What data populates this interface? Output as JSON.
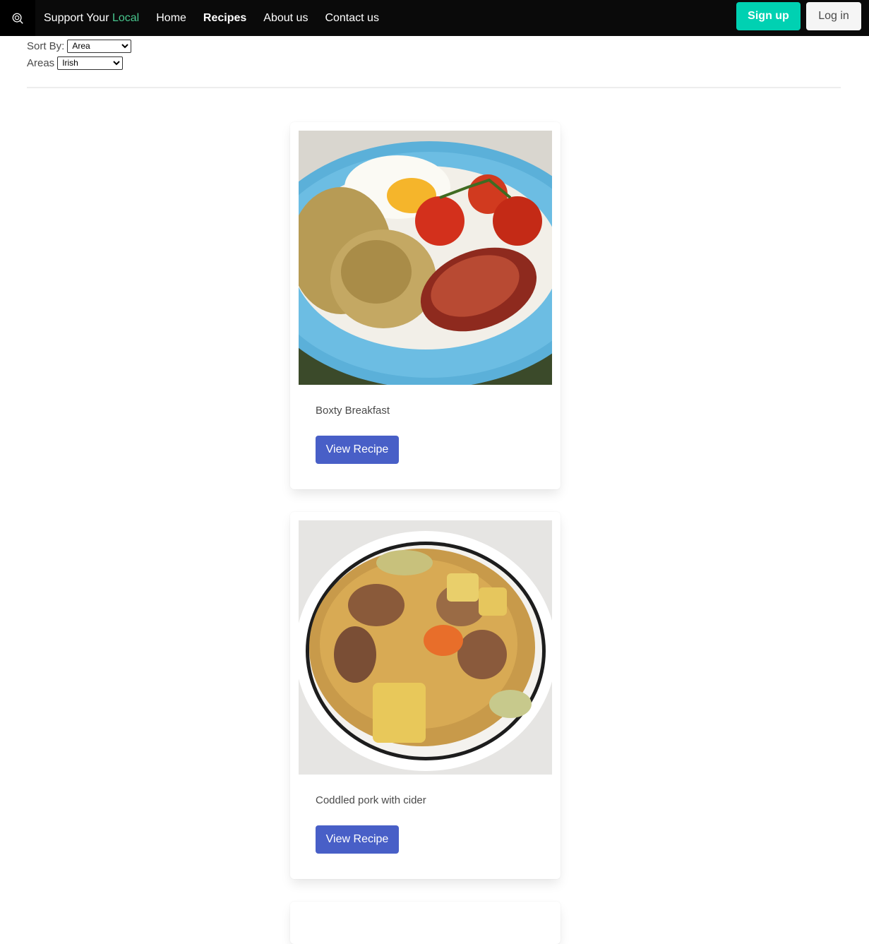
{
  "nav": {
    "brand_prefix": "Support Your",
    "brand_accent": "Local",
    "links": [
      "Home",
      "Recipes",
      "About us",
      "Contact us"
    ],
    "active": "Recipes",
    "signup_label": "Sign up",
    "login_label": "Log in"
  },
  "filters": {
    "sort_label": "Sort By:",
    "sort_value": "Area",
    "areas_label": "Areas",
    "areas_value": "Irish"
  },
  "recipes": [
    {
      "title": "Boxty Breakfast",
      "button_label": "View Recipe",
      "image": "boxty-breakfast-photo"
    },
    {
      "title": "Coddled pork with cider",
      "button_label": "View Recipe",
      "image": "coddled-pork-photo"
    }
  ],
  "colors": {
    "navbar_bg": "#0a0a0a",
    "brand_accent": "#48c78e",
    "signup_bg": "#00d1b2",
    "view_button_bg": "#485fc7"
  }
}
